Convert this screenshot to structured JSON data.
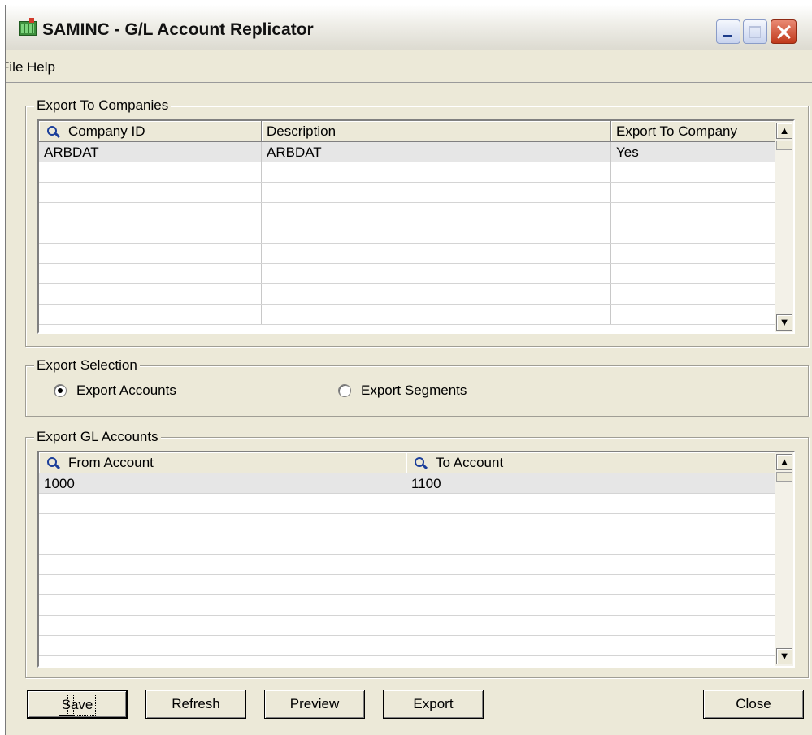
{
  "window": {
    "title": "SAMINC - G/L Account Replicator"
  },
  "menu": {
    "items": [
      {
        "label": "File"
      },
      {
        "label": "Help"
      }
    ]
  },
  "companies": {
    "group_label": "Export To Companies",
    "columns": [
      "Company ID",
      "Description",
      "Export To Company"
    ],
    "rows": [
      {
        "company_id": "ARBDAT",
        "description": "ARBDAT",
        "export": "Yes"
      }
    ]
  },
  "selection": {
    "group_label": "Export Selection",
    "options": [
      {
        "label": "Export Accounts",
        "checked": true
      },
      {
        "label": "Export Segments",
        "checked": false
      }
    ]
  },
  "accounts": {
    "group_label": "Export GL Accounts",
    "columns": [
      "From Account",
      "To Account"
    ],
    "rows": [
      {
        "from": "1000",
        "to": "1100"
      }
    ]
  },
  "buttons": {
    "save": {
      "first": "S",
      "rest": "ave"
    },
    "refresh": {
      "first": "R",
      "rest": "efresh"
    },
    "preview": {
      "first": "P",
      "rest": "review"
    },
    "export": {
      "first": "E",
      "rest": "xport"
    },
    "close": {
      "first": "C",
      "rest": "lose"
    }
  },
  "icons": {
    "column_lookup": "magnifier-icon",
    "app": "app-chart-icon"
  }
}
